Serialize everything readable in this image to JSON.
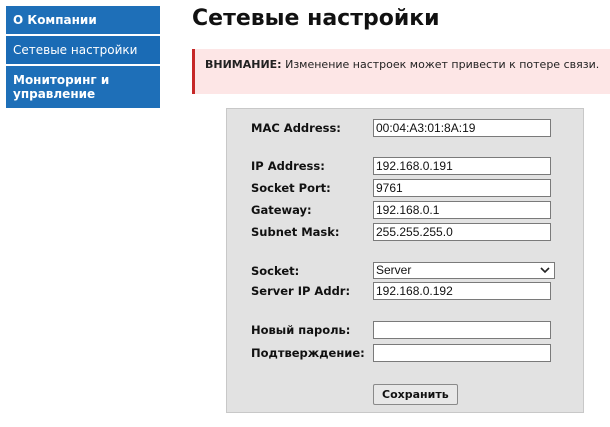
{
  "sidebar": {
    "items": [
      {
        "label": "О Компании",
        "active": false
      },
      {
        "label": "Сетевые настройки",
        "active": true
      },
      {
        "label": "Мониторинг и управление",
        "active": false
      }
    ]
  },
  "main": {
    "title": "Сетевые настройки",
    "alert": {
      "prefix": "ВНИМАНИЕ:",
      "text": " Изменение настроек может привести к потере связи."
    }
  },
  "form": {
    "mac": {
      "label": "MAC Address:",
      "value": "00:04:A3:01:8A:19"
    },
    "ip": {
      "label": "IP Address:",
      "value": "192.168.0.191"
    },
    "port": {
      "label": "Socket Port:",
      "value": "9761"
    },
    "gateway": {
      "label": "Gateway:",
      "value": "192.168.0.1"
    },
    "mask": {
      "label": "Subnet Mask:",
      "value": "255.255.255.0"
    },
    "socket": {
      "label": "Socket:",
      "value": "Server"
    },
    "server_ip": {
      "label": "Server IP Addr:",
      "value": "192.168.0.192"
    },
    "new_password": {
      "label": "Новый пароль:",
      "value": ""
    },
    "confirm": {
      "label": "Подтверждение:",
      "value": ""
    },
    "save_label": "Сохранить"
  },
  "colors": {
    "sidebar_bg": "#1e6fb8",
    "alert_bg": "#fde6e6",
    "alert_border": "#c62828",
    "panel_bg": "#e2e2e2"
  }
}
